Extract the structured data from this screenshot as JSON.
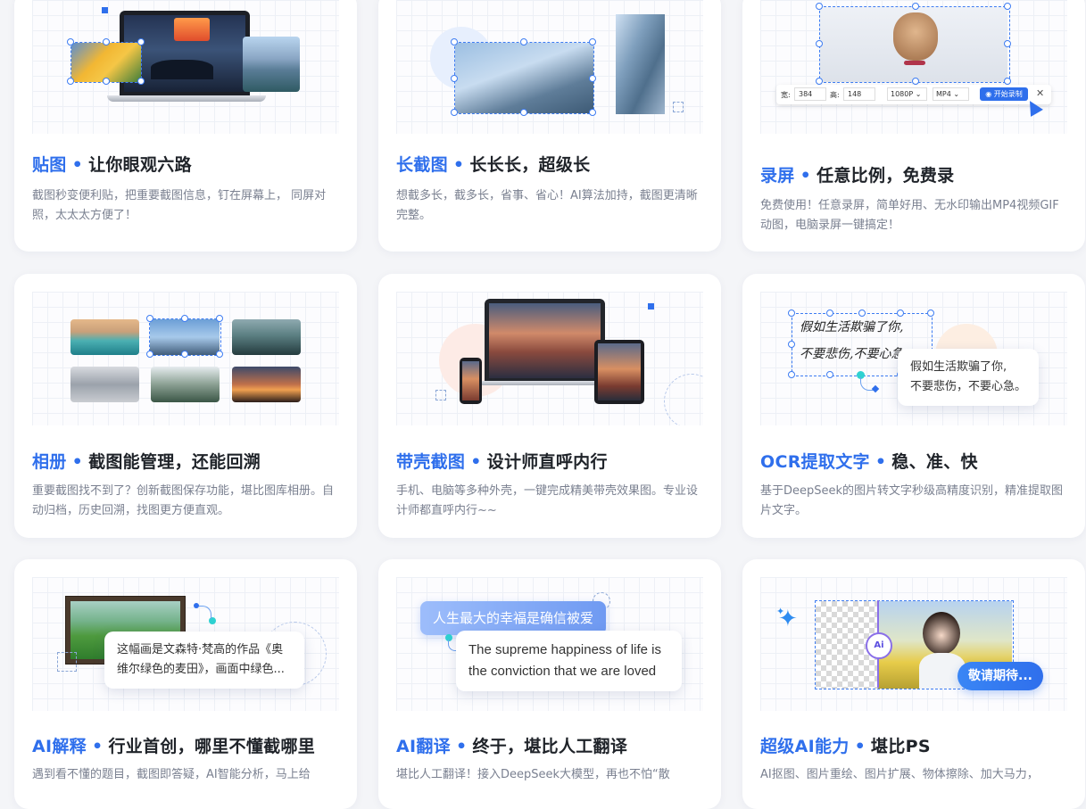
{
  "cards": [
    {
      "highlight": "贴图",
      "sep": "•",
      "rest": "让你眼观六路",
      "desc": "截图秒变便利贴，把重要截图信息，钉在屏幕上， 同屏对照，太太太方便了！"
    },
    {
      "highlight": "长截图",
      "sep": "•",
      "rest": "长长长，超级长",
      "desc": "想截多长，截多长，省事、省心！AI算法加持，截图更清晰完整。"
    },
    {
      "highlight": "录屏",
      "sep": "•",
      "rest": "任意比例，免费录",
      "desc": "免费使用！任意录屏，简单好用、无水印输出MP4视频GIF动图，电脑录屏一键搞定！"
    },
    {
      "highlight": "相册",
      "sep": "•",
      "rest": "截图能管理，还能回溯",
      "desc": "重要截图找不到了？创新截图保存功能，堪比图库相册。自动归档，历史回溯，找图更方便直观。"
    },
    {
      "highlight": "带壳截图",
      "sep": "•",
      "rest": "设计师直呼内行",
      "desc": "手机、电脑等多种外壳，一键完成精美带壳效果图。专业设计师都直呼内行~~"
    },
    {
      "highlight": "OCR提取文字",
      "sep": "•",
      "rest": "稳、准、快",
      "desc": "基于DeepSeek的图片转文字秒级高精度识别，精准提取图片文字。"
    },
    {
      "highlight": "AI解释",
      "sep": "•",
      "rest": "行业首创，哪里不懂截哪里",
      "desc": "遇到看不懂的题目，截图即答疑，AI智能分析，马上给"
    },
    {
      "highlight": "AI翻译",
      "sep": "•",
      "rest": "终于，堪比人工翻译",
      "desc": "堪比人工翻译！接入DeepSeek大模型，再也不怕“散"
    },
    {
      "highlight": "超级AI能力",
      "sep": "•",
      "rest": "堪比PS",
      "desc": "AI抠图、图片重绘、图片扩展、物体擦除、加大马力，"
    }
  ],
  "recorder": {
    "width_label": "宽:",
    "width_value": "384",
    "height_label": "高:",
    "height_value": "148",
    "resolution": "1080P",
    "format": "MP4",
    "start_button": "开始录制"
  },
  "ocr": {
    "handwriting_line1": "假如生活欺骗了你,",
    "handwriting_line2": "不要悲伤,不要心急。",
    "result_line1": "假如生活欺骗了你,",
    "result_line2": "不要悲伤，不要心急。"
  },
  "explain": {
    "bubble_text": "这幅画是文森特·梵高的作品《奥维尔绿色的麦田》，画面中绿色..."
  },
  "translate": {
    "source": "人生最大的幸福是确信被爱",
    "target": "The supreme happiness of life is the conviction that we are loved"
  },
  "ai": {
    "badge": "敬请期待...",
    "icon_label": "Ai"
  }
}
